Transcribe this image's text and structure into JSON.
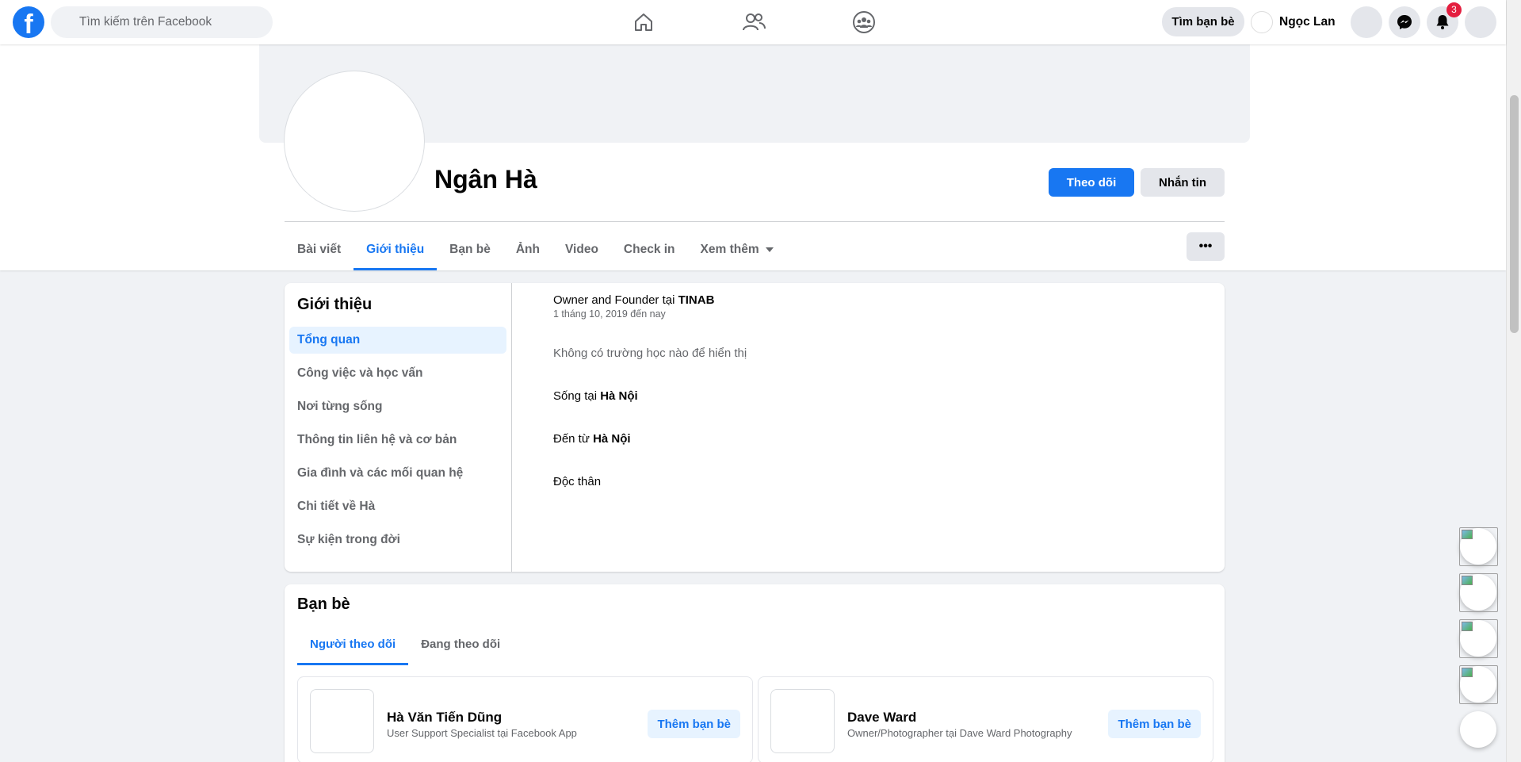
{
  "topbar": {
    "logo_letter": "f",
    "search_placeholder": "Tìm kiếm trên Facebook",
    "find_friends_label": "Tìm bạn bè",
    "user_name": "Ngọc Lan",
    "notification_count": "3",
    "brand_color": "#1877f2"
  },
  "profile": {
    "name": "Ngân Hà",
    "follow_label": "Theo dõi",
    "message_label": "Nhắn tin",
    "more_label": "•••",
    "tabs": [
      {
        "label": "Bài viết"
      },
      {
        "label": "Giới thiệu"
      },
      {
        "label": "Bạn bè"
      },
      {
        "label": "Ảnh"
      },
      {
        "label": "Video"
      },
      {
        "label": "Check in"
      },
      {
        "label": "Xem thêm"
      }
    ]
  },
  "about": {
    "title": "Giới thiệu",
    "menu": [
      {
        "label": "Tổng quan"
      },
      {
        "label": "Công việc và học vấn"
      },
      {
        "label": "Nơi từng sống"
      },
      {
        "label": "Thông tin liên hệ và cơ bản"
      },
      {
        "label": "Gia đình và các mối quan hệ"
      },
      {
        "label": "Chi tiết về Hà"
      },
      {
        "label": "Sự kiện trong đời"
      }
    ],
    "work_prefix": "Owner and Founder tại ",
    "work_company": "TINAB",
    "work_date": "1 tháng 10, 2019 đến nay",
    "school_text": "Không có trường học nào để hiển thị",
    "lives_prefix": "Sống tại ",
    "lives_place": "Hà Nội",
    "from_prefix": "Đến từ ",
    "from_place": "Hà Nội",
    "relationship": "Độc thân"
  },
  "friends": {
    "title": "Bạn bè",
    "tabs": [
      {
        "label": "Người theo dõi"
      },
      {
        "label": "Đang theo dõi"
      }
    ],
    "items": [
      {
        "name": "Hà Văn Tiến Dũng",
        "subtitle": "User Support Specialist tại Facebook App",
        "add_label": "Thêm bạn bè"
      },
      {
        "name": "Dave Ward",
        "subtitle": "Owner/Photographer tại Dave Ward Photography",
        "add_label": "Thêm bạn bè"
      }
    ]
  }
}
